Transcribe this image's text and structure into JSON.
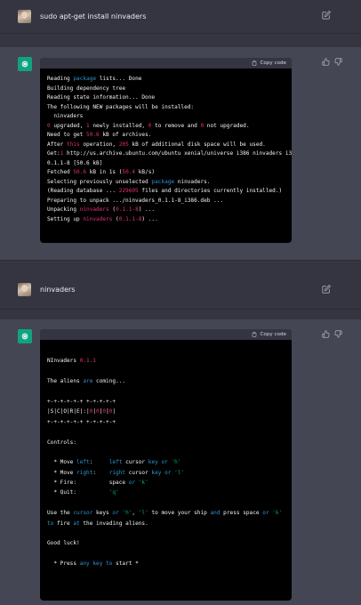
{
  "conversation": {
    "message1": {
      "text": "sudo apt-get install ninvaders"
    },
    "message2": {
      "text": "ninvaders"
    }
  },
  "code_blocks": {
    "copy_label": "Copy code",
    "block1": [
      [
        [
          "Reading ",
          ""
        ],
        [
          "package",
          "blue"
        ],
        [
          " lists... Done",
          ""
        ]
      ],
      [
        [
          "Building dependency tree",
          ""
        ]
      ],
      [
        [
          "Reading state information... Done",
          ""
        ]
      ],
      [
        [
          "The following NEW packages will be installed:",
          ""
        ]
      ],
      [
        [
          "  ninvaders",
          ""
        ]
      ],
      [
        [
          "0",
          "num"
        ],
        [
          " upgraded, ",
          ""
        ],
        [
          "1",
          "num"
        ],
        [
          " newly installed, ",
          ""
        ],
        [
          "0",
          "num"
        ],
        [
          " to remove and ",
          ""
        ],
        [
          "0",
          "num"
        ],
        [
          " not upgraded.",
          ""
        ]
      ],
      [
        [
          "Need to get ",
          ""
        ],
        [
          "50.6",
          "num"
        ],
        [
          " kB of archives.",
          ""
        ]
      ],
      [
        [
          "After ",
          ""
        ],
        [
          "this",
          "red"
        ],
        [
          " operation, ",
          ""
        ],
        [
          "205",
          "num"
        ],
        [
          " kB of additional disk space will be used.",
          ""
        ]
      ],
      [
        [
          "Get:",
          ""
        ],
        [
          "1",
          "num"
        ],
        [
          " http://us.archive.ubuntu.com/ubuntu xenial/universe i386 ninvaders i386",
          ""
        ]
      ],
      [
        [
          "0.1.1-8 [50.6 kB]",
          ""
        ]
      ],
      [
        [
          "Fetched ",
          ""
        ],
        [
          "50.6",
          "num"
        ],
        [
          " kB in 1s (",
          ""
        ],
        [
          "50.4",
          "num"
        ],
        [
          " kB/s)",
          ""
        ]
      ],
      [
        [
          "Selecting previously unselected ",
          ""
        ],
        [
          "package",
          "blue"
        ],
        [
          " ninvaders.",
          ""
        ]
      ],
      [
        [
          "(Reading database ... ",
          ""
        ],
        [
          "229605",
          "num"
        ],
        [
          " files and directories currently installed.)",
          ""
        ]
      ],
      [
        [
          "Preparing to unpack .../ninvaders_0.1.1-8_i386.deb ...",
          ""
        ]
      ],
      [
        [
          "Unpacking ",
          ""
        ],
        [
          "ninvaders",
          "red"
        ],
        [
          " (",
          ""
        ],
        [
          "0.1.1-8",
          "num"
        ],
        [
          ") ...",
          ""
        ]
      ],
      [
        [
          "Setting up ",
          ""
        ],
        [
          "ninvaders",
          "red"
        ],
        [
          " (",
          ""
        ],
        [
          "0.1.1-8",
          "num"
        ],
        [
          ") ...",
          ""
        ]
      ]
    ],
    "block2": [
      [
        [
          "",
          ""
        ]
      ],
      [
        [
          "NInvaders ",
          ""
        ],
        [
          "0.1.1",
          "num"
        ]
      ],
      [
        [
          "",
          ""
        ]
      ],
      [
        [
          "The aliens ",
          ""
        ],
        [
          "are",
          "blue"
        ],
        [
          " coming...",
          ""
        ]
      ],
      [
        [
          "",
          ""
        ]
      ],
      [
        [
          "+-+-+-+-+-+ +-+-+-+-+",
          ""
        ]
      ],
      [
        [
          "|S|C|O|R|E|:|",
          ""
        ],
        [
          "0",
          "num"
        ],
        [
          "|",
          ""
        ],
        [
          "0",
          "num"
        ],
        [
          "|",
          ""
        ],
        [
          "0",
          "num"
        ],
        [
          "|",
          ""
        ],
        [
          "0",
          "num"
        ],
        [
          "|",
          ""
        ]
      ],
      [
        [
          "+-+-+-+-+-+ +-+-+-+-+",
          ""
        ]
      ],
      [
        [
          "",
          ""
        ]
      ],
      [
        [
          "Controls:",
          ""
        ]
      ],
      [
        [
          "",
          ""
        ]
      ],
      [
        [
          "  * Move ",
          ""
        ],
        [
          "left",
          "blue"
        ],
        [
          ":     ",
          ""
        ],
        [
          "left",
          "blue"
        ],
        [
          " cursor ",
          ""
        ],
        [
          "key",
          "blue"
        ],
        [
          " ",
          ""
        ],
        [
          "or",
          "blue"
        ],
        [
          " ",
          ""
        ],
        [
          "'h'",
          "str"
        ]
      ],
      [
        [
          "  * Move ",
          ""
        ],
        [
          "right",
          "blue"
        ],
        [
          ":    ",
          ""
        ],
        [
          "right",
          "blue"
        ],
        [
          " cursor ",
          ""
        ],
        [
          "key",
          "blue"
        ],
        [
          " ",
          ""
        ],
        [
          "or",
          "blue"
        ],
        [
          " ",
          ""
        ],
        [
          "'l'",
          "str"
        ]
      ],
      [
        [
          "  * Fire:          space ",
          ""
        ],
        [
          "or",
          "blue"
        ],
        [
          " ",
          ""
        ],
        [
          "'k'",
          "str"
        ]
      ],
      [
        [
          "  * Quit:          ",
          ""
        ],
        [
          "'q'",
          "str"
        ]
      ],
      [
        [
          "",
          ""
        ]
      ],
      [
        [
          "Use the ",
          ""
        ],
        [
          "cursor",
          "blue"
        ],
        [
          " keys ",
          ""
        ],
        [
          "or",
          "blue"
        ],
        [
          " ",
          ""
        ],
        [
          "'h'",
          "str"
        ],
        [
          ", ",
          ""
        ],
        [
          "'l'",
          "str"
        ],
        [
          " to move your ship ",
          ""
        ],
        [
          "and",
          "blue"
        ],
        [
          " press space ",
          ""
        ],
        [
          "or",
          "blue"
        ],
        [
          " ",
          ""
        ],
        [
          "'k'",
          "str"
        ]
      ],
      [
        [
          "to",
          "blue"
        ],
        [
          " fire ",
          ""
        ],
        [
          "at",
          "blue"
        ],
        [
          " the invading aliens.",
          ""
        ]
      ],
      [
        [
          "",
          ""
        ]
      ],
      [
        [
          "Good luck!",
          ""
        ]
      ],
      [
        [
          "",
          ""
        ]
      ],
      [
        [
          "  * Press ",
          ""
        ],
        [
          "any",
          "blue"
        ],
        [
          " ",
          ""
        ],
        [
          "key",
          "blue"
        ],
        [
          " ",
          ""
        ],
        [
          "to",
          "blue"
        ],
        [
          " start *",
          ""
        ]
      ]
    ]
  },
  "colors": {
    "background_user": "#343541",
    "background_assistant": "#444654",
    "code_bg": "#000000",
    "accent_green": "#10a37f",
    "token_blue": "#2e95d3",
    "token_red": "#df3079",
    "token_green": "#00a67d"
  },
  "icons": {
    "edit": "pencil-square-icon",
    "copy": "clipboard-icon",
    "thumbs_up": "thumbs-up-icon",
    "thumbs_down": "thumbs-down-icon",
    "assistant": "openai-logo-icon",
    "user": "user-avatar"
  }
}
